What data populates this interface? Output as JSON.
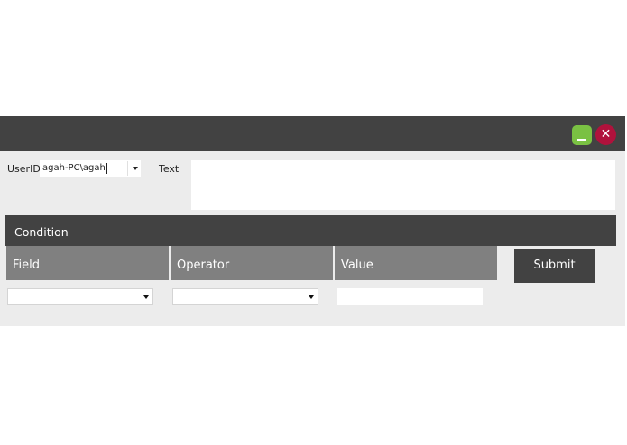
{
  "titlebar": {
    "minimize_symbol": "_",
    "close_symbol": "✕",
    "minimize_color": "#7ac143",
    "close_color": "#b0123c"
  },
  "form": {
    "userid_label": "UserID",
    "userid_value": "agah-PC\\agah",
    "text_label": "Text",
    "text_value": ""
  },
  "condition": {
    "title": "Condition",
    "columns": [
      "Field",
      "Operator",
      "Value"
    ],
    "submit_label": "Submit",
    "field_selected": "",
    "operator_selected": "",
    "value_input": ""
  },
  "icons": [
    "minimize-icon",
    "close-icon",
    "chevron-down-icon"
  ]
}
